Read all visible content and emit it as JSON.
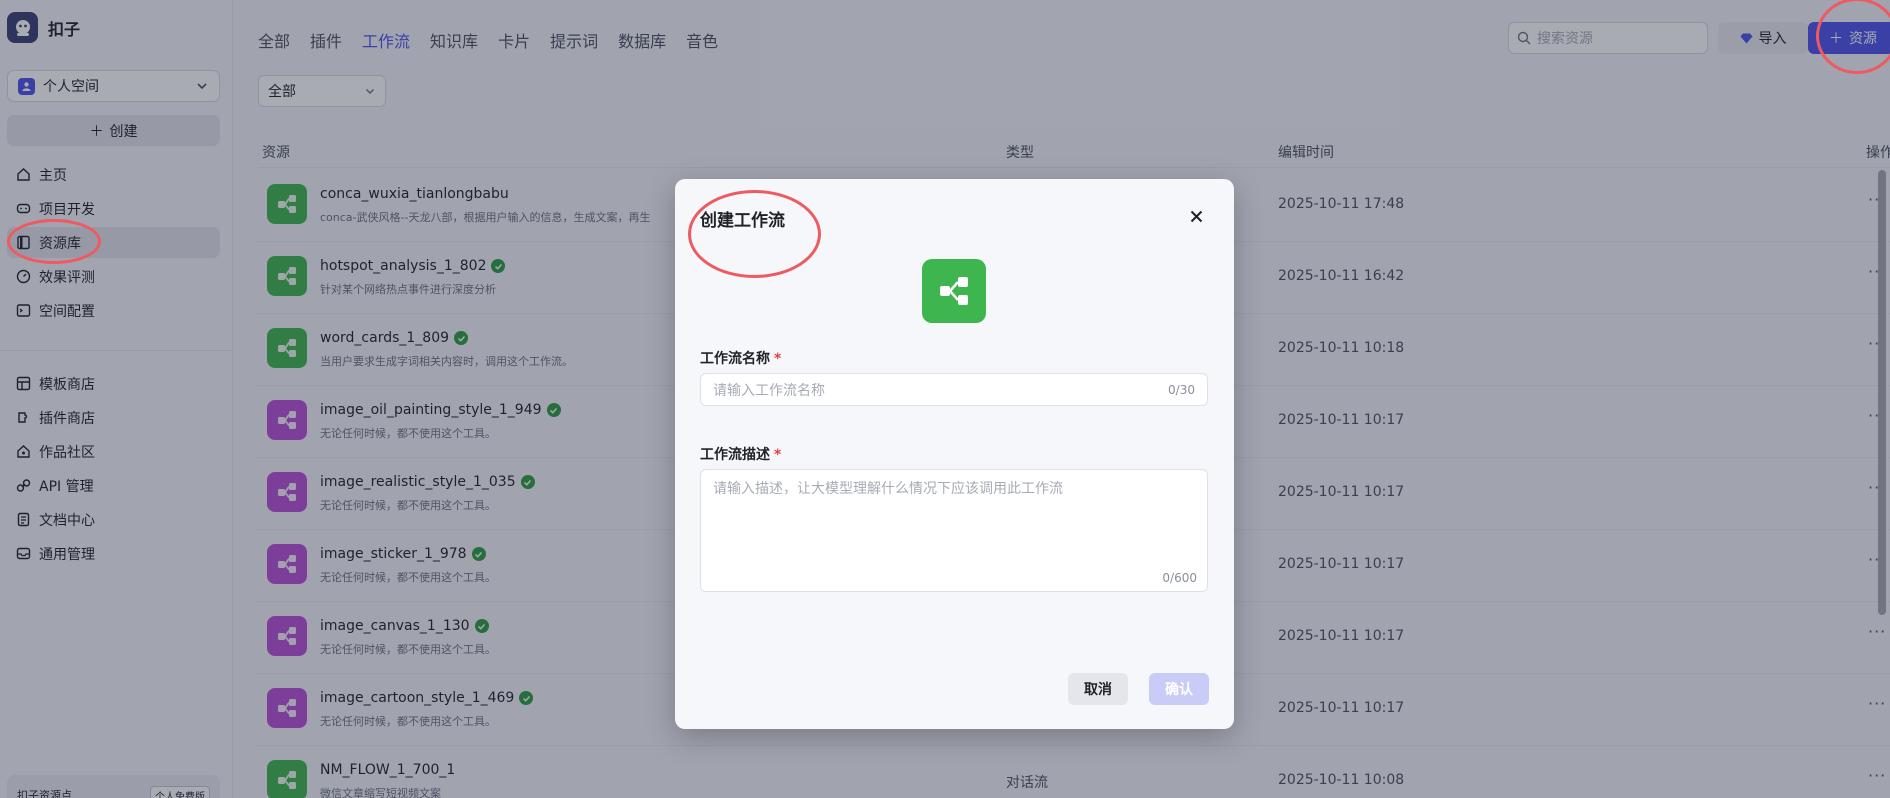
{
  "app": {
    "name": "扣子"
  },
  "sidebar": {
    "space_label": "个人空间",
    "create_label": "创建",
    "nav_primary": [
      {
        "label": "主页",
        "icon": "home-icon"
      },
      {
        "label": "项目开发",
        "icon": "gamepad-icon"
      },
      {
        "label": "资源库",
        "icon": "library-icon",
        "active": true
      },
      {
        "label": "效果评测",
        "icon": "gauge-icon"
      },
      {
        "label": "空间配置",
        "icon": "terminal-icon"
      }
    ],
    "nav_secondary": [
      {
        "label": "模板商店",
        "icon": "template-icon"
      },
      {
        "label": "插件商店",
        "icon": "plugin-icon"
      },
      {
        "label": "作品社区",
        "icon": "community-icon"
      },
      {
        "label": "API 管理",
        "icon": "link-icon"
      },
      {
        "label": "文档中心",
        "icon": "document-icon"
      },
      {
        "label": "通用管理",
        "icon": "inbox-icon"
      }
    ],
    "quota_label": "扣子资源点",
    "quota_badge": "个人免费版"
  },
  "header": {
    "tabs": [
      "全部",
      "插件",
      "工作流",
      "知识库",
      "卡片",
      "提示词",
      "数据库",
      "音色"
    ],
    "active_tab": "工作流",
    "search_placeholder": "搜索资源",
    "import_label": "导入",
    "resource_label": "资源",
    "filter_value": "全部"
  },
  "table": {
    "columns": {
      "resource": "资源",
      "type": "类型",
      "time": "编辑时间",
      "action": "操作"
    },
    "rows": [
      {
        "name": "conca_wuxia_tianlongbabu",
        "desc": "conca-武侠风格--天龙八部，根据用户输入的信息，生成文案，再生",
        "type": "",
        "time": "2025-10-11 17:48",
        "color": "green",
        "verified": false
      },
      {
        "name": "hotspot_analysis_1_802",
        "desc": "针对某个网络热点事件进行深度分析",
        "type": "",
        "time": "2025-10-11 16:42",
        "color": "green",
        "verified": true
      },
      {
        "name": "word_cards_1_809",
        "desc": "当用户要求生成字词相关内容时，调用这个工作流。",
        "type": "",
        "time": "2025-10-11 10:18",
        "color": "green",
        "verified": true
      },
      {
        "name": "image_oil_painting_style_1_949",
        "desc": "无论任何时候，都不使用这个工具。",
        "type": "",
        "time": "2025-10-11 10:17",
        "color": "purple",
        "verified": true
      },
      {
        "name": "image_realistic_style_1_035",
        "desc": "无论任何时候，都不使用这个工具。",
        "type": "",
        "time": "2025-10-11 10:17",
        "color": "purple",
        "verified": true
      },
      {
        "name": "image_sticker_1_978",
        "desc": "无论任何时候，都不使用这个工具。",
        "type": "",
        "time": "2025-10-11 10:17",
        "color": "purple",
        "verified": true
      },
      {
        "name": "image_canvas_1_130",
        "desc": "无论任何时候，都不使用这个工具。",
        "type": "",
        "time": "2025-10-11 10:17",
        "color": "purple",
        "verified": true
      },
      {
        "name": "image_cartoon_style_1_469",
        "desc": "无论任何时候，都不使用这个工具。",
        "type": "",
        "time": "2025-10-11 10:17",
        "color": "purple",
        "verified": true
      },
      {
        "name": "NM_FLOW_1_700_1",
        "desc": "微信文章缩写短视频文案",
        "type": "对话流",
        "time": "2025-10-11 10:08",
        "color": "green",
        "verified": false
      }
    ],
    "more_label": "···"
  },
  "modal": {
    "title": "创建工作流",
    "name_label": "工作流名称",
    "name_placeholder": "请输入工作流名称",
    "name_counter": "0/30",
    "desc_label": "工作流描述",
    "desc_placeholder": "请输入描述，让大模型理解什么情况下应该调用此工作流",
    "desc_counter": "0/600",
    "required_mark": "*",
    "cancel_label": "取消",
    "confirm_label": "确认"
  },
  "colors": {
    "accent": "#4d53e8",
    "workflow_green": "#3fb54f",
    "image_purple": "#b64fd3",
    "annotation_red": "#ee5a5f"
  }
}
